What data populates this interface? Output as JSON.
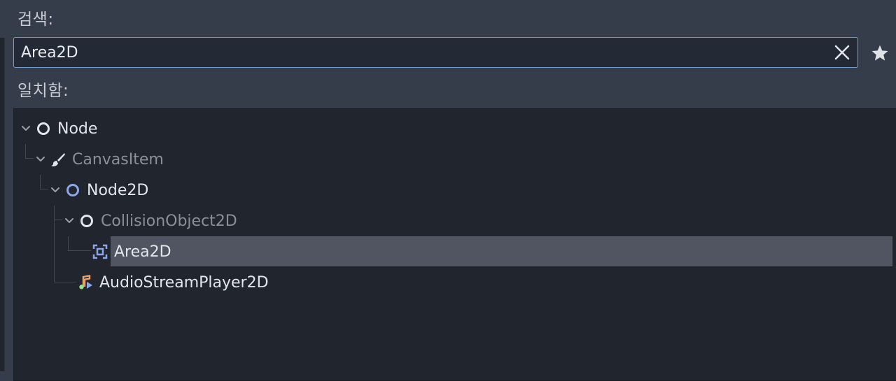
{
  "search": {
    "label": "검색:",
    "value": "Area2D",
    "clear_icon": "close-icon",
    "favorite_icon": "star-icon"
  },
  "matches": {
    "label": "일치함:"
  },
  "tree": {
    "nodes": [
      {
        "label": "Node",
        "icon": "node-circle-icon",
        "depth": 0,
        "expanded": true,
        "matched": true
      },
      {
        "label": "CanvasItem",
        "icon": "brush-icon",
        "depth": 1,
        "expanded": true,
        "matched": false
      },
      {
        "label": "Node2D",
        "icon": "node2d-circle-icon",
        "depth": 2,
        "expanded": true,
        "matched": true
      },
      {
        "label": "CollisionObject2D",
        "icon": "collision-circle-icon",
        "depth": 3,
        "expanded": true,
        "matched": false
      },
      {
        "label": "Area2D",
        "icon": "area2d-icon",
        "depth": 4,
        "selected": true,
        "matched": true
      },
      {
        "label": "AudioStreamPlayer2D",
        "icon": "audio-note-icon",
        "depth": 3,
        "matched": true
      }
    ]
  },
  "colors": {
    "background": "#363d4a",
    "panel": "#21262e",
    "accent": "#6f9ed6",
    "selection": "#505561",
    "node2d_blue": "#8da6e8"
  }
}
